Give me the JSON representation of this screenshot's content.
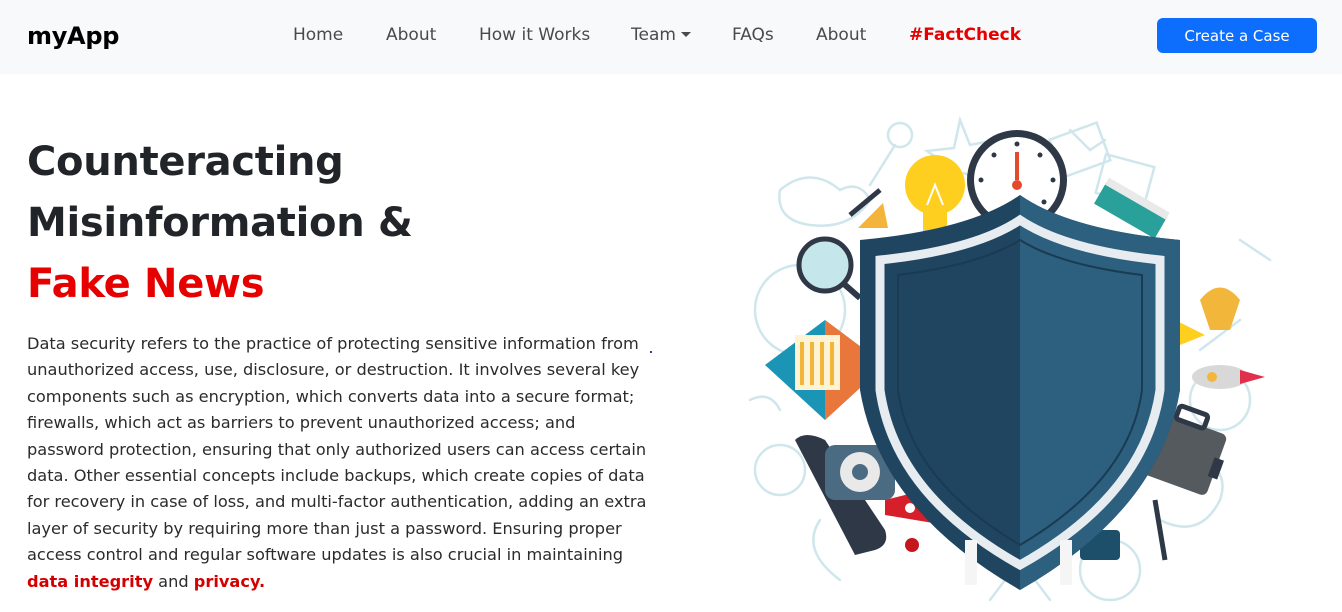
{
  "brand": "myApp",
  "nav": {
    "home": "Home",
    "about": "About",
    "how_it_works": "How it Works",
    "team": "Team",
    "faqs": "FAQs",
    "about2": "About",
    "factcheck": "#FactCheck"
  },
  "cta_label": "Create a Case",
  "hero": {
    "line1": "Counteracting",
    "line2": "Misinformation &",
    "line3": "Fake News"
  },
  "description": {
    "text": "Data security refers to the practice of protecting sensitive information from unauthorized access, use, disclosure, or destruction. It involves several key components such as encryption, which converts data into a secure format; firewalls, which act as barriers to prevent unauthorized access; and password protection, ensuring that only authorized users can access certain data. Other essential concepts include backups, which create copies of data for recovery in case of loss, and multi-factor authentication, adding an extra layer of security by requiring more than just a password. Ensuring proper access control and regular software updates is also crucial in maintaining ",
    "link1": "data integrity",
    "connector": " and ",
    "link2": "privacy."
  },
  "colors": {
    "accent": "#e60000",
    "primary": "#0d6efd",
    "shield": "#2d5f7f"
  },
  "illustration_icons": [
    "shield-icon",
    "clock-icon",
    "lightbulb-icon",
    "magnifier-icon",
    "envelope-icon",
    "telephone-icon",
    "megaphone-icon",
    "briefcase-icon",
    "trophy-icon",
    "rocket-icon"
  ]
}
